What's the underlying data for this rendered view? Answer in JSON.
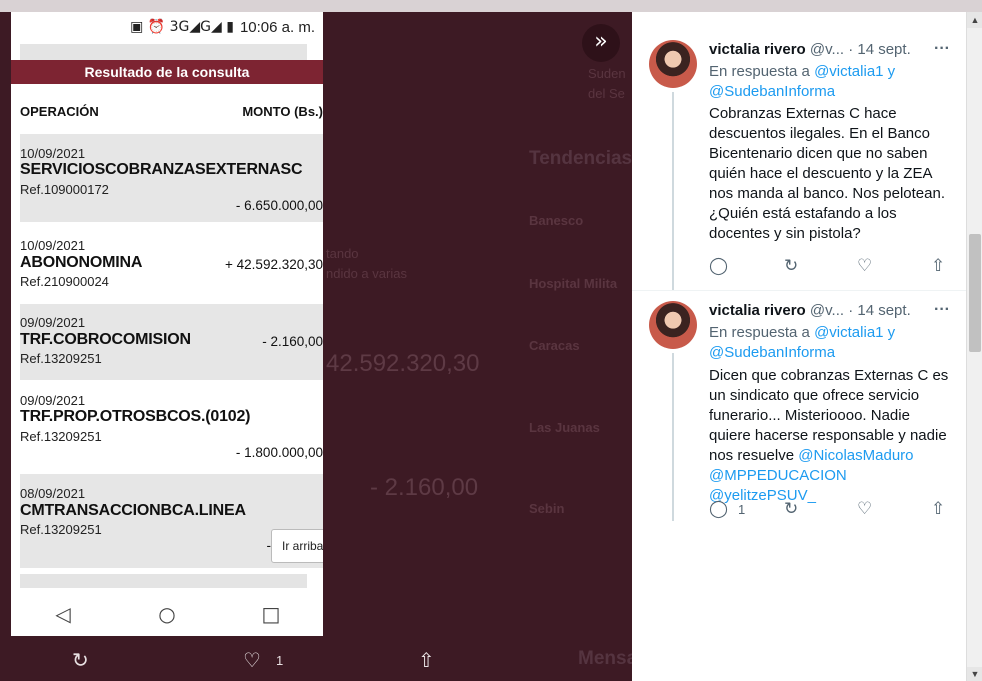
{
  "phone": {
    "status": {
      "icons": "▣ ⏰ 3G◢G◢ ▮",
      "time": "10:06 a. m."
    },
    "header": "Resultado de la consulta",
    "columns": {
      "operation": "OPERACIÓN",
      "amount": "MONTO (Bs.)"
    },
    "transactions": [
      {
        "date": "10/09/2021",
        "name": "SERVICIOSCOBRANZASEXTERNASC",
        "ref": "Ref.109000172",
        "amount": "- 6.650.000,00"
      },
      {
        "date": "10/09/2021",
        "name": "ABONONOMINA",
        "ref": "Ref.210900024",
        "amount": "+ 42.592.320,30"
      },
      {
        "date": "09/09/2021",
        "name": "TRF.COBROCOMISION",
        "ref": "Ref.13209251",
        "amount": "- 2.160,00"
      },
      {
        "date": "09/09/2021",
        "name": "TRF.PROP.OTROSBCOS.(0102)",
        "ref": "Ref.13209251",
        "amount": "- 1.800.000,00"
      },
      {
        "date": "08/09/2021",
        "name": "CMTRANSACCIONBCA.LINEA",
        "ref": "Ref.13209251",
        "amount": "-"
      }
    ],
    "scroll_top_label": "Ir arriba",
    "nav": {
      "back": "◁",
      "home": "○",
      "recent": "□"
    }
  },
  "bottom_actions": {
    "retweet": "↻",
    "like": "♡",
    "like_count": "1",
    "share": "⇧"
  },
  "background": {
    "trends_title": "Tendencias",
    "trends": [
      "Banesco",
      "Hospital Milita",
      "Caracas",
      "Las Juanas",
      "Sebin"
    ],
    "big_amount_1": "42.592.320,30",
    "big_amount_2": "- 2.160,00",
    "snippet_1": "tando",
    "snippet_2": "ndido a varias",
    "messages_label": "Mensa",
    "search_snippet_1": "Suden",
    "search_snippet_2": "del Se"
  },
  "expand_icon": "»",
  "tweets": [
    {
      "name": "victalia rivero",
      "handle": "@v...",
      "date": "· 14 sept.",
      "more": "···",
      "reply_prefix": "En respuesta a",
      "reply_to_1": "@victalia1",
      "reply_joiner": "y",
      "reply_to_2": "@SudebanInforma",
      "text": "Cobranzas Externas C hace descuentos ilegales. En el Banco Bicentenario dicen que no saben quién hace el descuento y la ZEA nos manda al banco. Nos pelotean. ¿Quién está estafando a los docentes y sin pistola?",
      "reply_count": "",
      "icons": {
        "reply": "◯",
        "retweet": "↻",
        "like": "♡",
        "share": "⇧"
      }
    },
    {
      "name": "victalia rivero",
      "handle": "@v...",
      "date": "· 14 sept.",
      "more": "···",
      "reply_prefix": "En respuesta a",
      "reply_to_1": "@victalia1",
      "reply_joiner": "y",
      "reply_to_2": "@SudebanInforma",
      "text_plain": "Dicen que cobranzas Externas C es un sindicato que ofrece servicio funerario... Misterioooo. Nadie quiere hacerse responsable y nadie nos resuelve",
      "mention_1": "@NicolasMaduro",
      "mention_2": "@MPPEDUCACION",
      "mention_3": "@yelitzePSUV_",
      "reply_count": "1",
      "icons": {
        "reply": "◯",
        "retweet": "↻",
        "like": "♡",
        "share": "⇧"
      }
    }
  ],
  "scrollbar": {
    "up": "▲",
    "down": "▼"
  }
}
